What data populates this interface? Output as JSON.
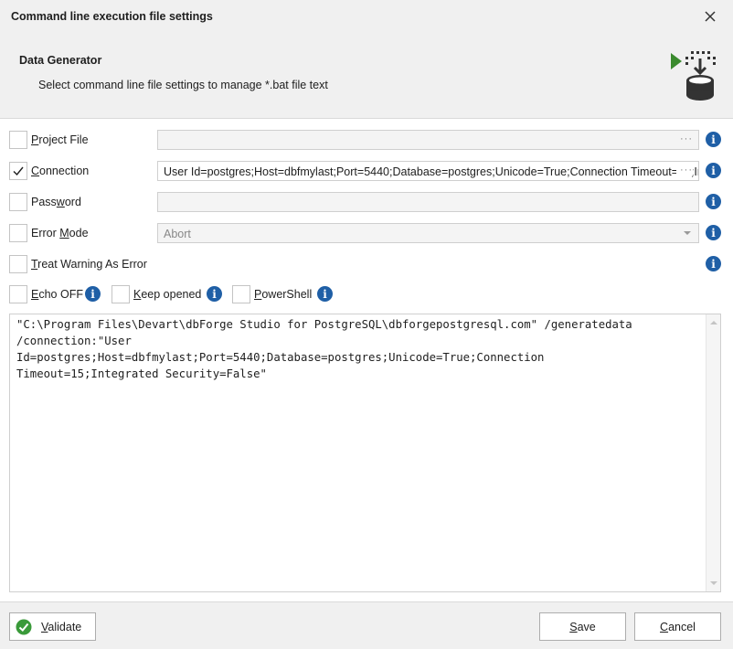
{
  "window": {
    "title": "Command line execution file settings"
  },
  "header": {
    "title": "Data Generator",
    "subtitle": "Select command line file settings to manage *.bat file text"
  },
  "fields": {
    "project_file": {
      "label_pre": "",
      "label_u": "P",
      "label_post": "roject File",
      "checked": false,
      "value": "",
      "button": "···"
    },
    "connection": {
      "label_pre": "",
      "label_u": "C",
      "label_post": "onnection",
      "checked": true,
      "value": "User Id=postgres;Host=dbfmylast;Port=5440;Database=postgres;Unicode=True;Connection Timeout=15;Integrated Security=False",
      "button": "···"
    },
    "password": {
      "label_pre": "Pass",
      "label_u": "w",
      "label_post": "ord",
      "checked": false,
      "value": ""
    },
    "error_mode": {
      "label_pre": "Error ",
      "label_u": "M",
      "label_post": "ode",
      "checked": false,
      "value": "Abort"
    },
    "treat_warning": {
      "label_pre": "",
      "label_u": "T",
      "label_post": "reat Warning As Error",
      "checked": false
    }
  },
  "options": {
    "echo_off": {
      "label_pre": "",
      "label_u": "E",
      "label_post": "cho OFF",
      "checked": false
    },
    "keep_opened": {
      "label_pre": "",
      "label_u": "K",
      "label_post": "eep opened",
      "checked": false
    },
    "powershell": {
      "label_pre": "",
      "label_u": "P",
      "label_post": "owerShell",
      "checked": false
    }
  },
  "command_text": "\"C:\\Program Files\\Devart\\dbForge Studio for PostgreSQL\\dbforgepostgresql.com\" /generatedata\n/connection:\"User\nId=postgres;Host=dbfmylast;Port=5440;Database=postgres;Unicode=True;Connection\nTimeout=15;Integrated Security=False\"",
  "footer": {
    "validate": {
      "label_u": "V",
      "label_post": "alidate"
    },
    "save": {
      "label_u": "S",
      "label_post": "ave"
    },
    "cancel": {
      "label_pre": "",
      "label_u": "C",
      "label_post": "ancel"
    }
  },
  "icons": {
    "close": "close-icon",
    "info": "info-icon",
    "check": "checkmark-icon",
    "validate": "green-check-icon",
    "header": "data-generator-icon"
  },
  "colors": {
    "info_blue": "#1f5fa6",
    "validate_green": "#3a9a3a",
    "header_green": "#3a8a2e"
  }
}
